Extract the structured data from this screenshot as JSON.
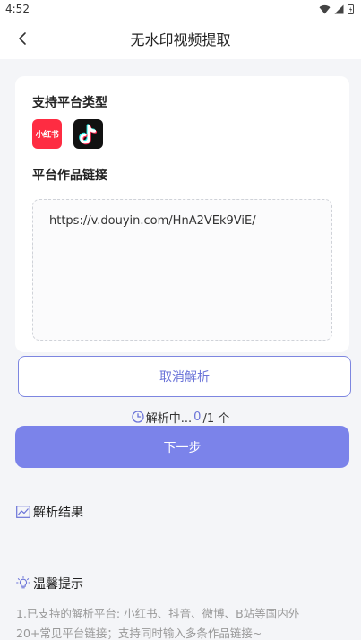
{
  "status_bar": {
    "time": "4:52"
  },
  "nav": {
    "title": "无水印视频提取"
  },
  "platforms": {
    "section_title": "支持平台类型",
    "items": [
      {
        "name": "小红书",
        "color": "#fe2c42"
      },
      {
        "name": "抖音",
        "color": "#111111"
      }
    ]
  },
  "link": {
    "section_title": "平台作品链接",
    "value": "https://v.douyin.com/HnA2VEk9ViE/"
  },
  "actions": {
    "cancel_label": "取消解析",
    "progress_label": "解析中...",
    "progress_done": "0",
    "progress_total": "/1 个",
    "next_label": "下一步"
  },
  "result": {
    "title": "解析结果"
  },
  "tips": {
    "title": "温馨提示",
    "line1": "1.已支持的解析平台: 小红书、抖音、微博、B站等国内外",
    "line2": "20+常见平台链接；支持同时输入多条作品链接~"
  },
  "colors": {
    "accent": "#7b83ea",
    "accent_text": "#6b74d8",
    "background": "#f4f5f8"
  }
}
